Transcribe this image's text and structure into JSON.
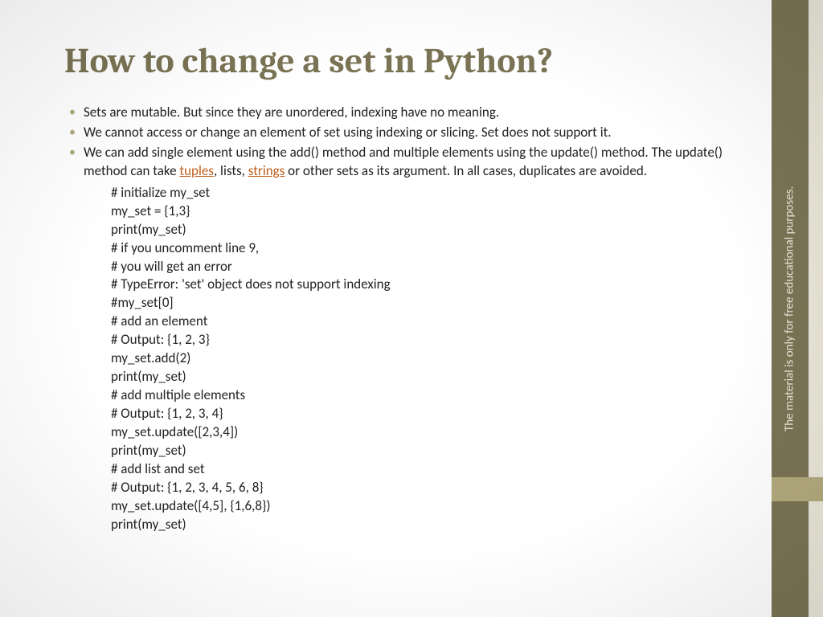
{
  "title": "How to change a set in Python?",
  "bullets": {
    "b1": "Sets are mutable. But since they are unordered, indexing have no meaning.",
    "b2": "We cannot access or change an element of set using indexing or slicing. Set does not support it.",
    "b3_pre": "We can add single element using the add() method and multiple elements using the update() method. The update() method can take ",
    "b3_link1": "tuples",
    "b3_mid1": ", lists, ",
    "b3_link2": "strings",
    "b3_post": " or other sets as its argument. In all cases, duplicates are avoided."
  },
  "code": [
    "# initialize my_set",
    "my_set = {1,3}",
    "print(my_set)",
    "# if you uncomment line 9,",
    "# you will get an error",
    "# TypeError: 'set' object does not support indexing",
    "#my_set[0]",
    "# add an element",
    "# Output: {1, 2, 3}",
    "my_set.add(2)",
    "print(my_set)",
    "# add multiple elements",
    "# Output: {1, 2, 3, 4}",
    "my_set.update([2,3,4])",
    "print(my_set)",
    "# add list and set",
    "# Output: {1, 2, 3, 4, 5, 6, 8}",
    "my_set.update([4,5], {1,6,8})",
    "print(my_set)"
  ],
  "sidebar_text": "The material is only for free educational purposes."
}
